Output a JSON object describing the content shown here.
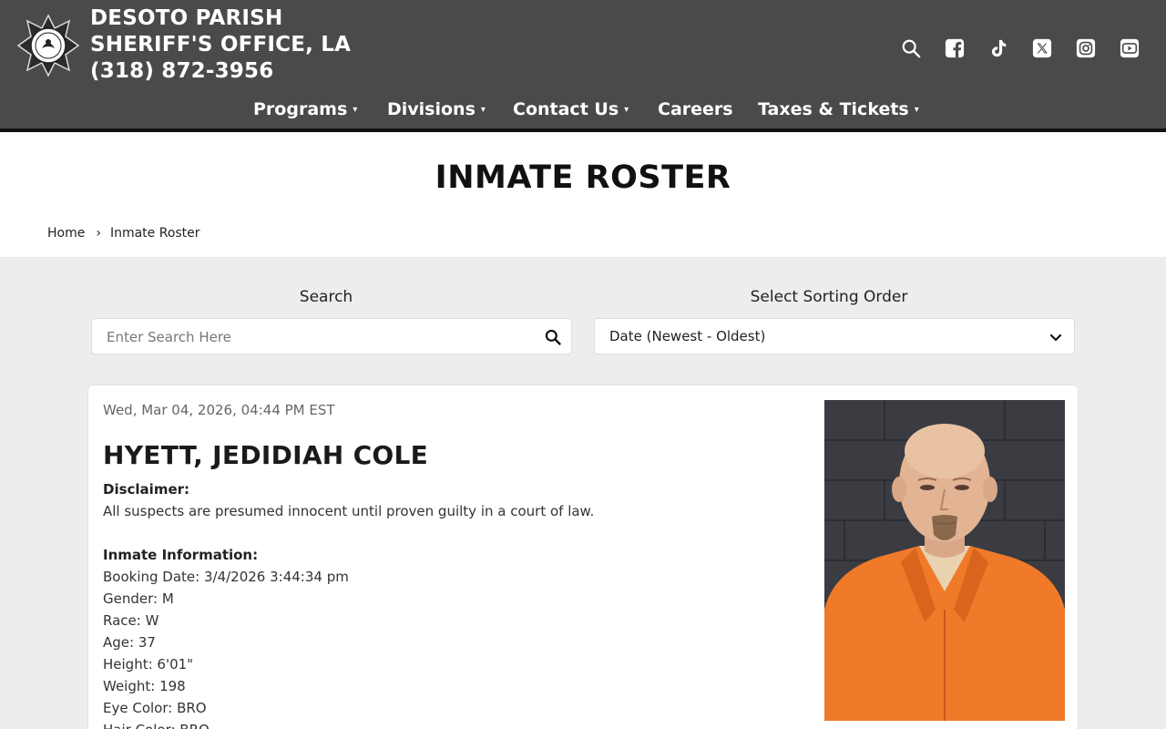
{
  "site": {
    "title_lines": [
      "DESOTO PARISH",
      "SHERIFF'S OFFICE, LA",
      "(318) 872-3956"
    ]
  },
  "header_icons": [
    "search-icon",
    "facebook-icon",
    "tiktok-icon",
    "x-icon",
    "instagram-icon",
    "youtube-icon"
  ],
  "nav": {
    "items": [
      {
        "label": "Programs",
        "caret": "▾"
      },
      {
        "label": "Divisions",
        "caret": "▾"
      },
      {
        "label": "Contact Us",
        "caret": "▾"
      },
      {
        "label": "Careers",
        "caret": ""
      },
      {
        "label": "Taxes & Tickets",
        "caret": "▾"
      }
    ]
  },
  "page": {
    "title": "INMATE ROSTER",
    "breadcrumb": {
      "home": "Home",
      "separator": "›",
      "current": "Inmate Roster"
    }
  },
  "filters": {
    "search_label": "Search",
    "search_placeholder": "Enter Search Here",
    "sort_label": "Select Sorting Order",
    "sort_value": "Date (Newest - Oldest)"
  },
  "inmate": {
    "date": "Wed, Mar 04, 2026, 04:44 PM EST",
    "name": "HYETT, JEDIDIAH COLE",
    "disclaimer_heading": "Disclaimer:",
    "disclaimer_text": "All suspects are presumed innocent until proven guilty in a court of law.",
    "info_heading": "Inmate Information:",
    "fields": [
      "Booking Date: 3/4/2026 3:44:34 pm",
      "Gender: M",
      "Race: W",
      "Age: 37",
      "Height: 6'01\"",
      "Weight: 198",
      "Eye Color: BRO",
      "Hair Color: BRO"
    ]
  },
  "colors": {
    "header_bg": "#4a4a4a",
    "header_border": "#111111",
    "page_bg": "#ededed",
    "jumpsuit": "#f07a2a"
  }
}
